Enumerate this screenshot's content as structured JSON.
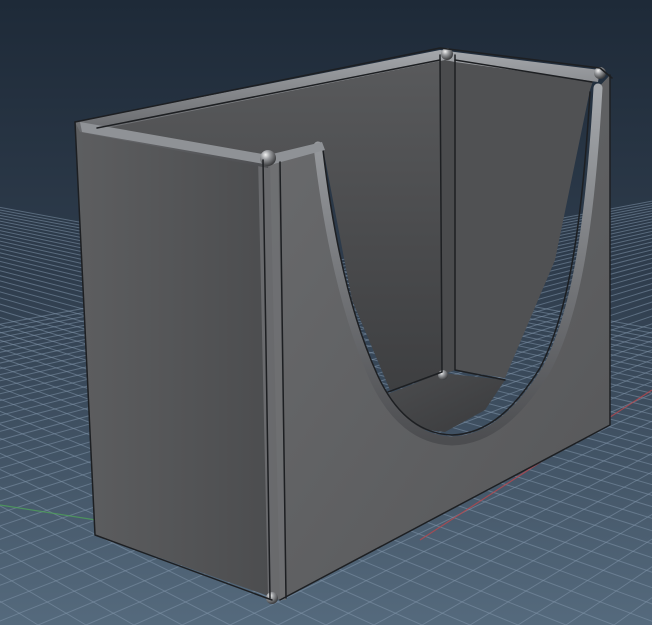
{
  "viewport": {
    "view": "perspective",
    "background_top": "#1e2a38",
    "background_bottom": "#4f6478",
    "grid_color": "#8ea3b8",
    "x_axis_color": "#b8474d",
    "y_axis_color": "#4ea05a"
  },
  "model": {
    "type": "open box with U-shaped cutout",
    "body_color": "#5a5b5d",
    "shadow_color": "#3f4042",
    "highlight_color": "#9da0a4",
    "edge_color": "#1d1f22"
  }
}
